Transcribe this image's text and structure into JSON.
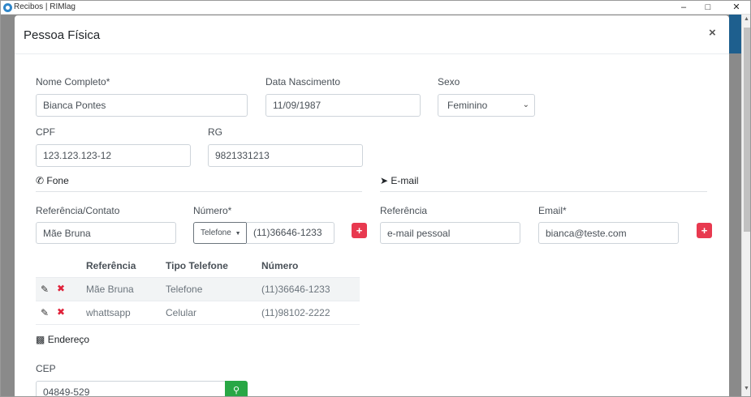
{
  "window": {
    "title": "Recibos | RIMlag"
  },
  "modal": {
    "title": "Pessoa Física",
    "close": "×"
  },
  "fields": {
    "nome": {
      "label": "Nome Completo*",
      "value": "Bianca Pontes"
    },
    "nascimento": {
      "label": "Data Nascimento",
      "value": "11/09/1987"
    },
    "sexo": {
      "label": "Sexo",
      "value": "Feminino"
    },
    "cpf": {
      "label": "CPF",
      "value": "123.123.123-12"
    },
    "rg": {
      "label": "RG",
      "value": "9821331213"
    }
  },
  "fone": {
    "title": "Fone",
    "ref_label": "Referência/Contato",
    "ref_value": "Mãe Bruna",
    "num_label": "Número*",
    "type_value": "Telefone",
    "num_value": "(11)36646-1233",
    "add": "+",
    "table": {
      "headers": [
        "Referência",
        "Tipo Telefone",
        "Número"
      ],
      "rows": [
        [
          "Mãe Bruna",
          "Telefone",
          "(11)36646-1233"
        ],
        [
          "whattsapp",
          "Celular",
          "(11)98102-2222"
        ]
      ]
    }
  },
  "email": {
    "title": "E-mail",
    "ref_label": "Referência",
    "ref_value": "e-mail pessoal",
    "email_label": "Email*",
    "email_value": "bianca@teste.com",
    "add": "+"
  },
  "endereco": {
    "title": "Endereço",
    "cep_label": "CEP",
    "cep_value": "04849-529"
  },
  "colors": {
    "accent_red": "#e8394f",
    "search_green": "#28a745",
    "header_blue": "#1e5f8e"
  },
  "icons": [
    "phone-icon",
    "paper-plane-icon",
    "address-card-icon",
    "pencil-icon",
    "times-icon",
    "search-icon"
  ]
}
